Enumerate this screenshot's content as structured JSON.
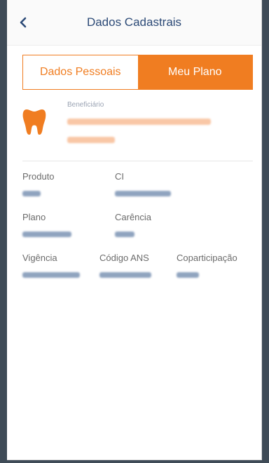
{
  "header": {
    "title": "Dados Cadastrais",
    "back_icon": "chevron-left-icon"
  },
  "tabs": [
    {
      "label": "Dados Pessoais",
      "active": false
    },
    {
      "label": "Meu Plano",
      "active": true
    }
  ],
  "beneficiary": {
    "icon": "tooth-icon",
    "label": "Beneficiário"
  },
  "fields": {
    "produto": {
      "label": "Produto"
    },
    "ci": {
      "label": "CI"
    },
    "plano": {
      "label": "Plano"
    },
    "carencia": {
      "label": "Carência"
    },
    "vigencia": {
      "label": "Vigência"
    },
    "codigo_ans": {
      "label": "Código ANS"
    },
    "coparticipacao": {
      "label": "Coparticipação"
    }
  },
  "colors": {
    "accent": "#f07d21",
    "header_text": "#2c4a77",
    "label_text": "#6b6b6b"
  }
}
